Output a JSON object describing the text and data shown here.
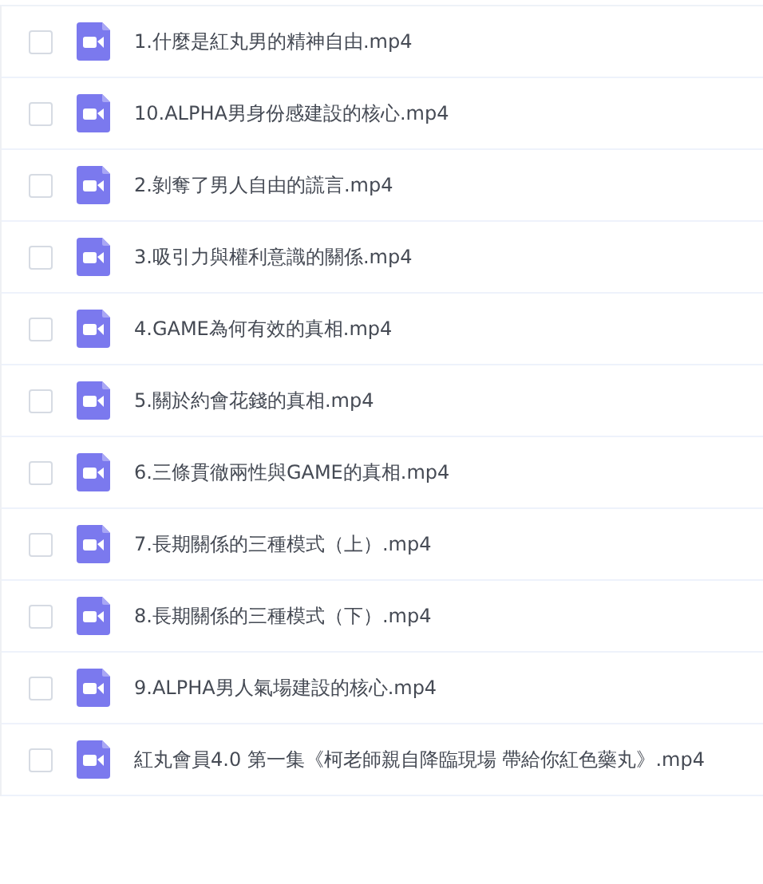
{
  "files": [
    {
      "name": "1.什麼是紅丸男的精神自由.mp4",
      "checked": false
    },
    {
      "name": "10.ALPHA男身份感建設的核心.mp4",
      "checked": false
    },
    {
      "name": "2.剝奪了男人自由的謊言.mp4",
      "checked": false
    },
    {
      "name": "3.吸引力與權利意識的關係.mp4",
      "checked": false
    },
    {
      "name": "4.GAME為何有效的真相.mp4",
      "checked": false
    },
    {
      "name": "5.關於約會花錢的真相.mp4",
      "checked": false
    },
    {
      "name": "6.三條貫徹兩性與GAME的真相.mp4",
      "checked": false
    },
    {
      "name": "7.長期關係的三種模式（上）.mp4",
      "checked": false
    },
    {
      "name": "8.長期關係的三種模式（下）.mp4",
      "checked": false
    },
    {
      "name": "9.ALPHA男人氣場建設的核心.mp4",
      "checked": false
    },
    {
      "name": "紅丸會員4.0 第一集《柯老師親自降臨現場 帶給你紅色藥丸》.mp4",
      "checked": false
    }
  ]
}
